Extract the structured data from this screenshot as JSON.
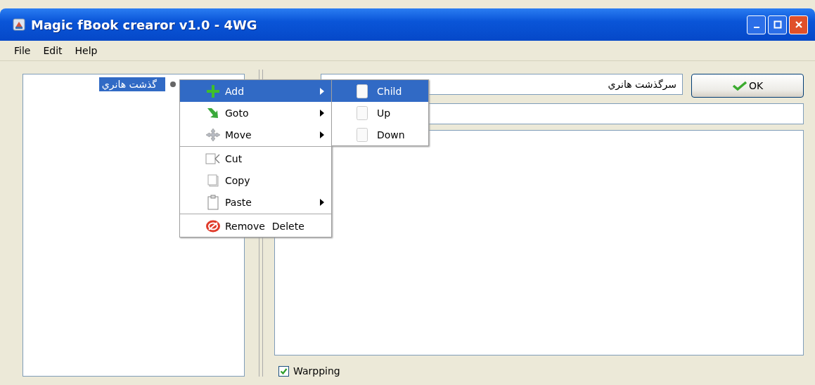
{
  "window": {
    "title": "Magic fBook crearor v1.0 - 4WG"
  },
  "menu_bar": [
    "File",
    "Edit",
    "Help"
  ],
  "tree": {
    "items": [
      {
        "label": "گذشت هانري",
        "selected": true
      }
    ]
  },
  "context_menu": {
    "items": [
      {
        "kind": "item",
        "label": "Add",
        "submenu": true,
        "selected": true
      },
      {
        "kind": "item",
        "label": "Goto",
        "submenu": true,
        "selected": false
      },
      {
        "kind": "item",
        "label": "Move",
        "submenu": true,
        "selected": false
      },
      {
        "kind": "separator"
      },
      {
        "kind": "item",
        "label": "Cut",
        "submenu": false,
        "selected": false
      },
      {
        "kind": "item",
        "label": "Copy",
        "submenu": false,
        "selected": false
      },
      {
        "kind": "item",
        "label": "Paste",
        "submenu": true,
        "selected": false
      },
      {
        "kind": "separator"
      },
      {
        "kind": "item",
        "label": "Remove",
        "shortcut": "Delete",
        "submenu": false,
        "selected": false
      }
    ]
  },
  "submenu": {
    "items": [
      {
        "label": "Child",
        "selected": true
      },
      {
        "label": "Up",
        "selected": false
      },
      {
        "label": "Down",
        "selected": false
      }
    ]
  },
  "title_field": {
    "value": "سرگذشت هانري"
  },
  "ok_button": {
    "label": "OK"
  },
  "wrapping_checkbox": {
    "label": "Warpping",
    "checked": true
  }
}
